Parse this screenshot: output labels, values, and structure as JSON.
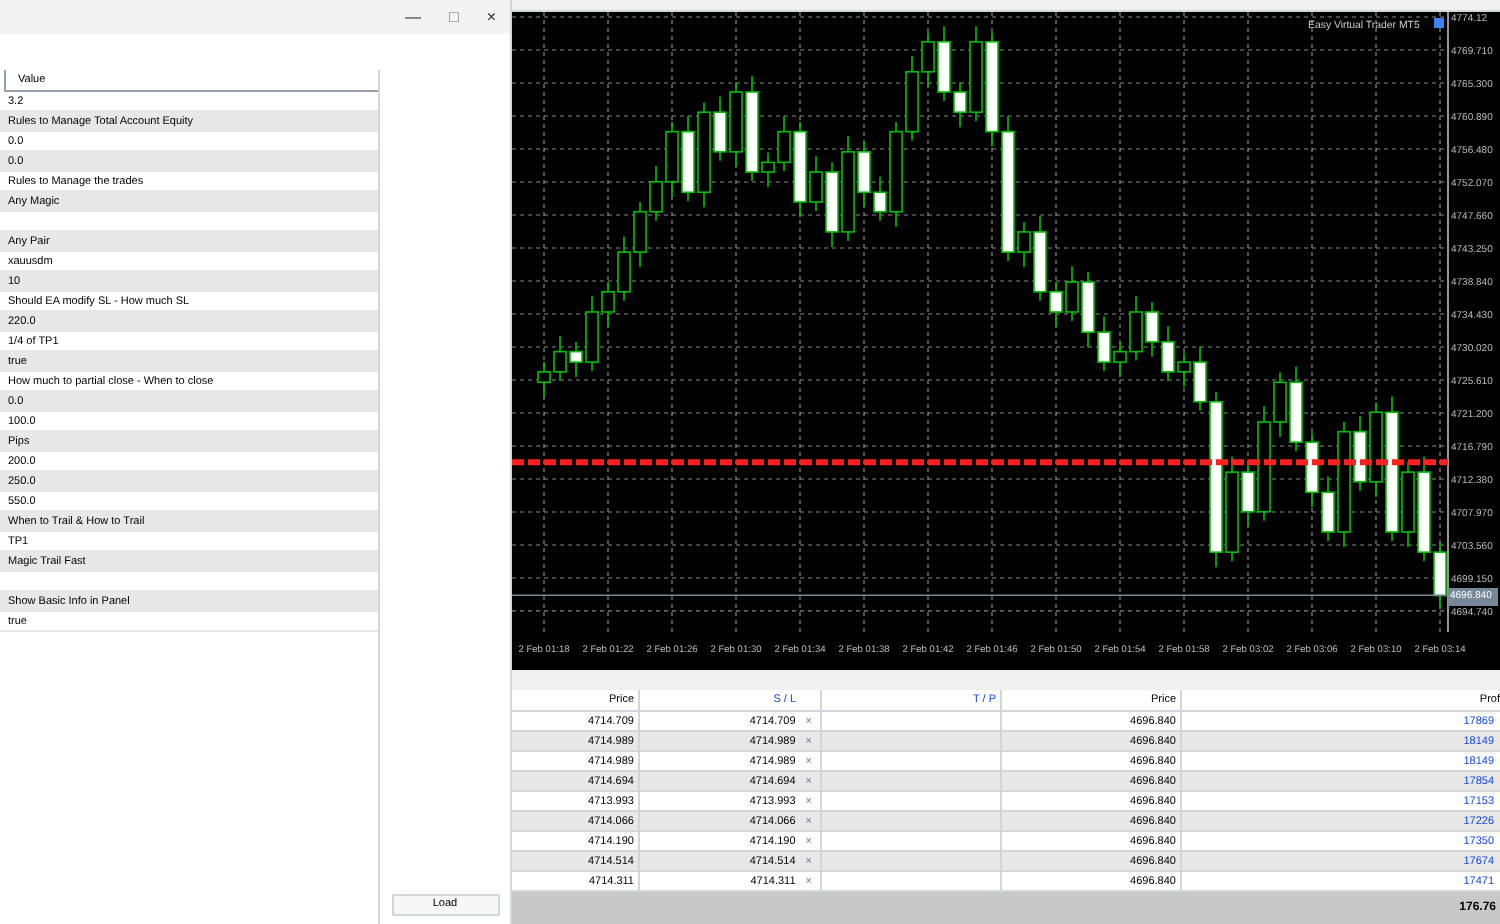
{
  "window": {
    "controls": [
      "—",
      "□",
      "×"
    ]
  },
  "properties": {
    "header": "Value",
    "rows": [
      "3.2",
      "Rules to Manage Total Account Equity",
      "0.0",
      "0.0",
      "Rules to Manage the trades",
      "Any Magic",
      "",
      "Any Pair",
      "xauusdm",
      "10",
      "Should EA modify SL - How much SL",
      "220.0",
      "1/4 of TP1",
      "true",
      "How much to partial close - When to close",
      "0.0",
      "100.0",
      "Pips",
      "200.0",
      "250.0",
      "550.0",
      "When to Trail & How to Trail",
      "TP1",
      "Magic Trail Fast",
      "",
      "Show Basic Info in Panel",
      "true"
    ]
  },
  "load_button": "Load",
  "chart": {
    "indicator": "Easy Virtual Trader MT5",
    "current_price": "4696.840",
    "chart_data": {
      "type": "candlestick",
      "categories": [
        "2 Feb 01:18",
        null,
        null,
        null,
        "2 Feb 01:22",
        null,
        null,
        null,
        "2 Feb 01:26",
        null,
        null,
        null,
        "2 Feb 01:30",
        null,
        null,
        null,
        "2 Feb 01:34",
        null,
        null,
        null,
        "2 Feb 01:38",
        null,
        null,
        null,
        "2 Feb 01:42",
        null,
        null,
        null,
        "2 Feb 01:46",
        null,
        null,
        null,
        "2 Feb 01:50",
        null,
        null,
        null,
        "2 Feb 01:54",
        null,
        null,
        null,
        "2 Feb 01:58",
        null,
        null,
        null,
        "2 Feb 03:02",
        null,
        null,
        null,
        "2 Feb 03:06",
        null,
        null,
        null,
        "2 Feb 03:10",
        null,
        null,
        null,
        "2 Feb 03:14"
      ],
      "ylim": [
        4691.93,
        4774.79
      ],
      "ohlc": [
        [
          4725.3,
          4728.0,
          4723.3,
          4726.7
        ],
        [
          4726.7,
          4731.5,
          4725.5,
          4729.4
        ],
        [
          4729.4,
          4730.7,
          4726.0,
          4728.0
        ],
        [
          4728.0,
          4736.8,
          4726.8,
          4734.7
        ],
        [
          4734.7,
          4738.7,
          4732.7,
          4737.4
        ],
        [
          4737.4,
          4744.8,
          4736.2,
          4742.7
        ],
        [
          4742.7,
          4749.4,
          4740.7,
          4748.1
        ],
        [
          4748.1,
          4754.2,
          4746.9,
          4752.1
        ],
        [
          4752.1,
          4760.1,
          4750.1,
          4758.8
        ],
        [
          4758.8,
          4760.9,
          4749.5,
          4750.7
        ],
        [
          4750.7,
          4762.7,
          4748.7,
          4761.4
        ],
        [
          4761.4,
          4763.5,
          4754.9,
          4756.1
        ],
        [
          4756.1,
          4765.4,
          4754.1,
          4764.1
        ],
        [
          4764.1,
          4766.2,
          4752.2,
          4753.4
        ],
        [
          4753.4,
          4756.0,
          4751.4,
          4754.7
        ],
        [
          4754.7,
          4760.9,
          4753.5,
          4758.8
        ],
        [
          4758.8,
          4760.1,
          4747.4,
          4749.4
        ],
        [
          4749.4,
          4755.5,
          4748.2,
          4753.4
        ],
        [
          4753.4,
          4754.7,
          4743.4,
          4745.4
        ],
        [
          4745.4,
          4758.2,
          4744.2,
          4756.1
        ],
        [
          4756.1,
          4757.4,
          4748.7,
          4750.7
        ],
        [
          4750.7,
          4752.8,
          4746.9,
          4748.1
        ],
        [
          4748.1,
          4760.1,
          4746.1,
          4758.8
        ],
        [
          4758.8,
          4768.9,
          4757.6,
          4766.8
        ],
        [
          4766.8,
          4772.1,
          4764.8,
          4770.8
        ],
        [
          4770.8,
          4772.9,
          4762.9,
          4764.1
        ],
        [
          4764.1,
          4765.4,
          4759.4,
          4761.4
        ],
        [
          4761.4,
          4772.9,
          4760.2,
          4770.8
        ],
        [
          4770.8,
          4772.1,
          4756.8,
          4758.8
        ],
        [
          4758.8,
          4760.9,
          4741.5,
          4742.7
        ],
        [
          4742.7,
          4746.7,
          4740.7,
          4745.4
        ],
        [
          4745.4,
          4747.5,
          4736.2,
          4737.4
        ],
        [
          4737.4,
          4738.7,
          4732.7,
          4734.7
        ],
        [
          4734.7,
          4740.8,
          4733.5,
          4738.7
        ],
        [
          4738.7,
          4740.0,
          4730.0,
          4732.0
        ],
        [
          4732.0,
          4734.1,
          4726.8,
          4728.0
        ],
        [
          4728.0,
          4730.7,
          4726.0,
          4729.4
        ],
        [
          4729.4,
          4736.8,
          4728.2,
          4734.7
        ],
        [
          4734.7,
          4736.0,
          4728.7,
          4730.7
        ],
        [
          4730.7,
          4732.8,
          4725.5,
          4726.7
        ],
        [
          4726.7,
          4729.3,
          4724.7,
          4728.0
        ],
        [
          4728.0,
          4730.1,
          4721.5,
          4722.7
        ],
        [
          4722.7,
          4724.0,
          4700.6,
          4702.6
        ],
        [
          4702.6,
          4715.4,
          4701.4,
          4713.3
        ],
        [
          4713.3,
          4714.6,
          4706.0,
          4708.0
        ],
        [
          4708.0,
          4722.1,
          4706.8,
          4720.0
        ],
        [
          4720.0,
          4726.6,
          4718.0,
          4725.3
        ],
        [
          4725.3,
          4727.4,
          4716.1,
          4717.3
        ],
        [
          4717.3,
          4718.6,
          4708.6,
          4710.6
        ],
        [
          4710.6,
          4712.7,
          4704.1,
          4705.3
        ],
        [
          4705.3,
          4720.0,
          4703.3,
          4718.7
        ],
        [
          4718.7,
          4720.8,
          4710.8,
          4712.0
        ],
        [
          4712.0,
          4722.6,
          4710.0,
          4721.3
        ],
        [
          4721.3,
          4723.4,
          4704.1,
          4705.3
        ],
        [
          4705.3,
          4714.6,
          4703.3,
          4713.3
        ],
        [
          4713.3,
          4715.4,
          4701.4,
          4702.6
        ],
        [
          4702.6,
          4703.9,
          4695.0,
          4696.8
        ]
      ],
      "yticks": [
        {
          "value": 4774.12,
          "label": "4774.12"
        },
        {
          "value": 4769.71,
          "label": "4769.710"
        },
        {
          "value": 4765.3,
          "label": "4765.300"
        },
        {
          "value": 4760.89,
          "label": "4760.890"
        },
        {
          "value": 4756.48,
          "label": "4756.480"
        },
        {
          "value": 4752.07,
          "label": "4752.070"
        },
        {
          "value": 4747.66,
          "label": "4747.660"
        },
        {
          "value": 4743.25,
          "label": "4743.250"
        },
        {
          "value": 4738.84,
          "label": "4738.840"
        },
        {
          "value": 4734.43,
          "label": "4734.430"
        },
        {
          "value": 4730.02,
          "label": "4730.020"
        },
        {
          "value": 4725.61,
          "label": "4725.610"
        },
        {
          "value": 4721.2,
          "label": "4721.200"
        },
        {
          "value": 4716.79,
          "label": "4716.790"
        },
        {
          "value": 4712.38,
          "label": "4712.380"
        },
        {
          "value": 4707.97,
          "label": "4707.970"
        },
        {
          "value": 4703.56,
          "label": "4703.560"
        },
        {
          "value": 4699.15,
          "label": "4699.150"
        },
        {
          "value": 4694.74,
          "label": "4694.740"
        }
      ],
      "grid": true,
      "ref_lines": [
        {
          "axis": "y",
          "value": 4714.6,
          "color": "#ff2020"
        },
        {
          "axis": "y",
          "value": 4696.84,
          "color": "#778899"
        }
      ]
    }
  },
  "trades": {
    "columns": [
      "Price",
      "S / L",
      "T / P",
      "Price",
      "Prof"
    ],
    "rows": [
      {
        "price": "4714.709",
        "sl": "4714.709",
        "sl_clear": "×",
        "current": "4696.840",
        "profit": "17869"
      },
      {
        "price": "4714.989",
        "sl": "4714.989",
        "sl_clear": "×",
        "current": "4696.840",
        "profit": "18149"
      },
      {
        "price": "4714.989",
        "sl": "4714.989",
        "sl_clear": "×",
        "current": "4696.840",
        "profit": "18149"
      },
      {
        "price": "4714.694",
        "sl": "4714.694",
        "sl_clear": "×",
        "current": "4696.840",
        "profit": "17854"
      },
      {
        "price": "4713.993",
        "sl": "4713.993",
        "sl_clear": "×",
        "current": "4696.840",
        "profit": "17153"
      },
      {
        "price": "4714.066",
        "sl": "4714.066",
        "sl_clear": "×",
        "current": "4696.840",
        "profit": "17226"
      },
      {
        "price": "4714.190",
        "sl": "4714.190",
        "sl_clear": "×",
        "current": "4696.840",
        "profit": "17350"
      },
      {
        "price": "4714.514",
        "sl": "4714.514",
        "sl_clear": "×",
        "current": "4696.840",
        "profit": "17674"
      },
      {
        "price": "4714.311",
        "sl": "4714.311",
        "sl_clear": "×",
        "current": "4696.840",
        "profit": "17471"
      }
    ],
    "total": "176.76"
  }
}
